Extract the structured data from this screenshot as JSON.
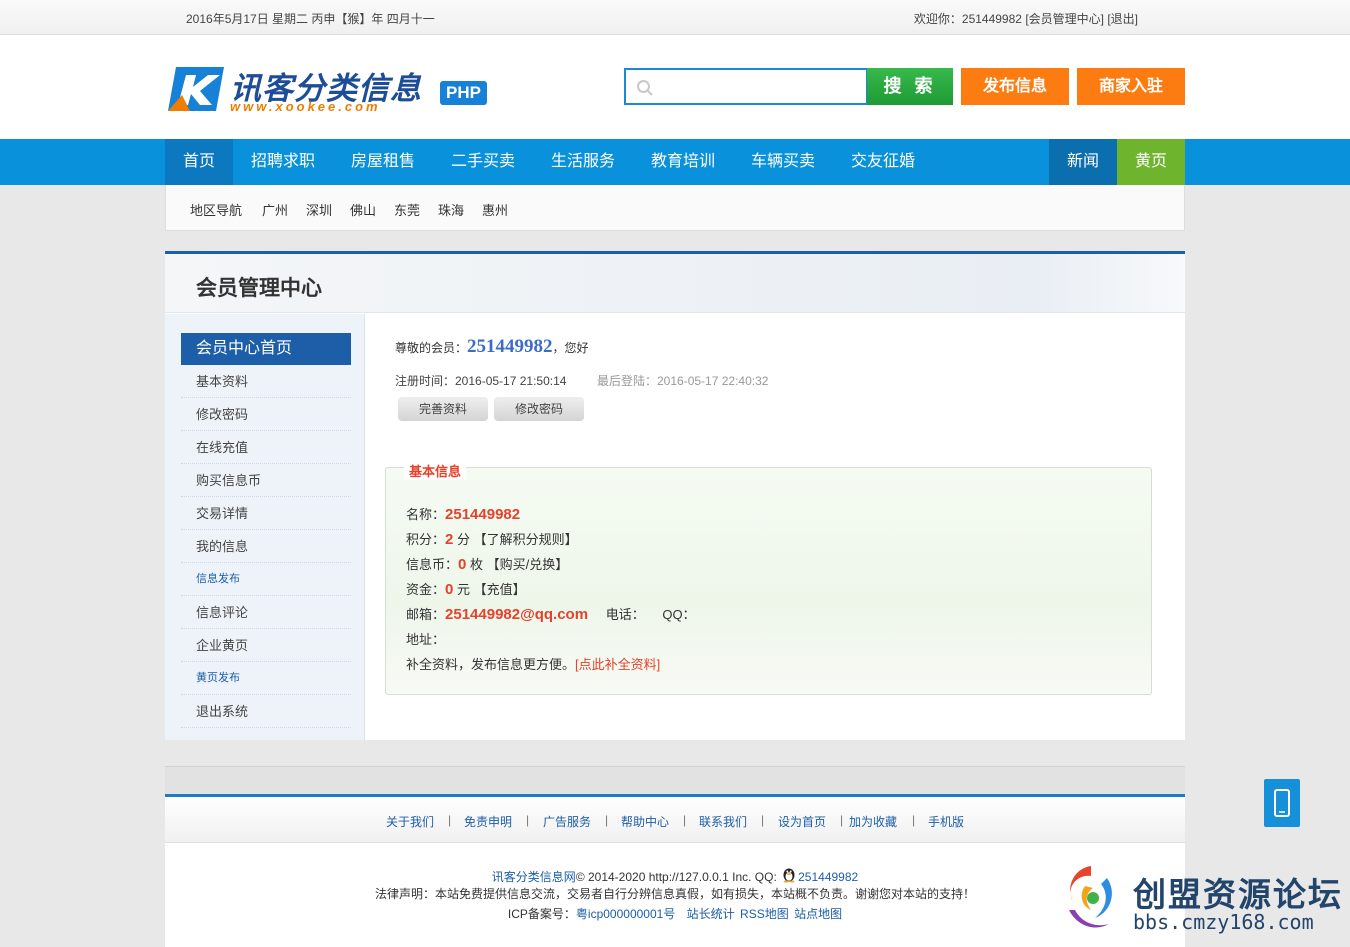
{
  "topbar": {
    "date": "2016年5月17日 星期二  丙申【猴】年 四月十一",
    "welcome": "欢迎你：251449982",
    "member_center": "[会员管理中心]",
    "logout": "[退出]"
  },
  "logo": {
    "name": "讯客分类信息",
    "url": "www.xookee.com",
    "badge": "PHP"
  },
  "search": {
    "placeholder": "",
    "button": "搜 索"
  },
  "header_buttons": {
    "post": "发布信息",
    "merchant": "商家入驻"
  },
  "nav": {
    "items": [
      "首页",
      "招聘求职",
      "房屋租售",
      "二手买卖",
      "生活服务",
      "教育培训",
      "车辆买卖",
      "交友征婚"
    ],
    "news": "新闻",
    "yellow_pages": "黄页"
  },
  "region": {
    "label": "地区导航",
    "cities": [
      "广州",
      "深圳",
      "佛山",
      "东莞",
      "珠海",
      "惠州"
    ]
  },
  "main": {
    "title": "会员管理中心"
  },
  "sidebar": {
    "head": "会员中心首页",
    "items": [
      "基本资料",
      "修改密码",
      "在线充值",
      "购买信息币",
      "交易详情",
      "我的信息",
      "信息发布",
      "信息评论",
      "企业黄页",
      "黄页发布",
      "退出系统"
    ]
  },
  "content": {
    "greet_prefix": "尊敬的会员：",
    "user_id": "251449982",
    "greet_suffix": "，您好",
    "reg_time": "注册时间：2016-05-17 21:50:14",
    "last_login": "最后登陆：2016-05-17 22:40:32",
    "btn_complete": "完善资料",
    "btn_password": "修改密码"
  },
  "info": {
    "legend": "基本信息",
    "name_label": "名称：",
    "name_value": "251449982",
    "points_label": "积分：",
    "points_value": "2",
    "points_unit": " 分 ",
    "points_link": "【了解积分规则】",
    "coins_label": "信息币：",
    "coins_value": "0",
    "coins_unit": " 枚 ",
    "coins_link": "【购买/兑换】",
    "funds_label": "资金：",
    "funds_value": "0",
    "funds_unit": " 元 ",
    "funds_link": "【充值】",
    "email_label": "邮箱：",
    "email_value": "251449982@qq.com",
    "phone_label": "电话：",
    "qq_label": "QQ：",
    "address_label": "地址：",
    "tip": "补全资料，发布信息更方便。",
    "tip_link": "[点此补全资料]"
  },
  "footer": {
    "links": [
      "关于我们",
      "免责申明",
      "广告服务",
      "帮助中心",
      "联系我们",
      "设为首页",
      "加为收藏",
      "手机版"
    ],
    "copyright_site": "讯客分类信息网",
    "copyright_rest": "© 2014-2020 http://127.0.0.1 Inc. QQ: ",
    "qq": "251449982",
    "legal": "法律声明：本站免费提供信息交流，交易者自行分辨信息真假，如有损失，本站概不负责。谢谢您对本站的支持！",
    "icp_label": "ICP备案号：",
    "icp_value": "粤icp000000001号",
    "stats": "站长统计",
    "rss": "RSS地图",
    "sitemap": "站点地图"
  },
  "watermark": {
    "name": "创盟资源论坛",
    "url": "bbs.cmzy168.com"
  },
  "colors": {
    "nav_blue": "#0a91dc",
    "brand_blue": "#1c5ea8",
    "orange": "#fc7c11",
    "green": "#1f9a35",
    "yellow_page_green": "#6fb42d",
    "highlight_red": "#e6412a"
  }
}
